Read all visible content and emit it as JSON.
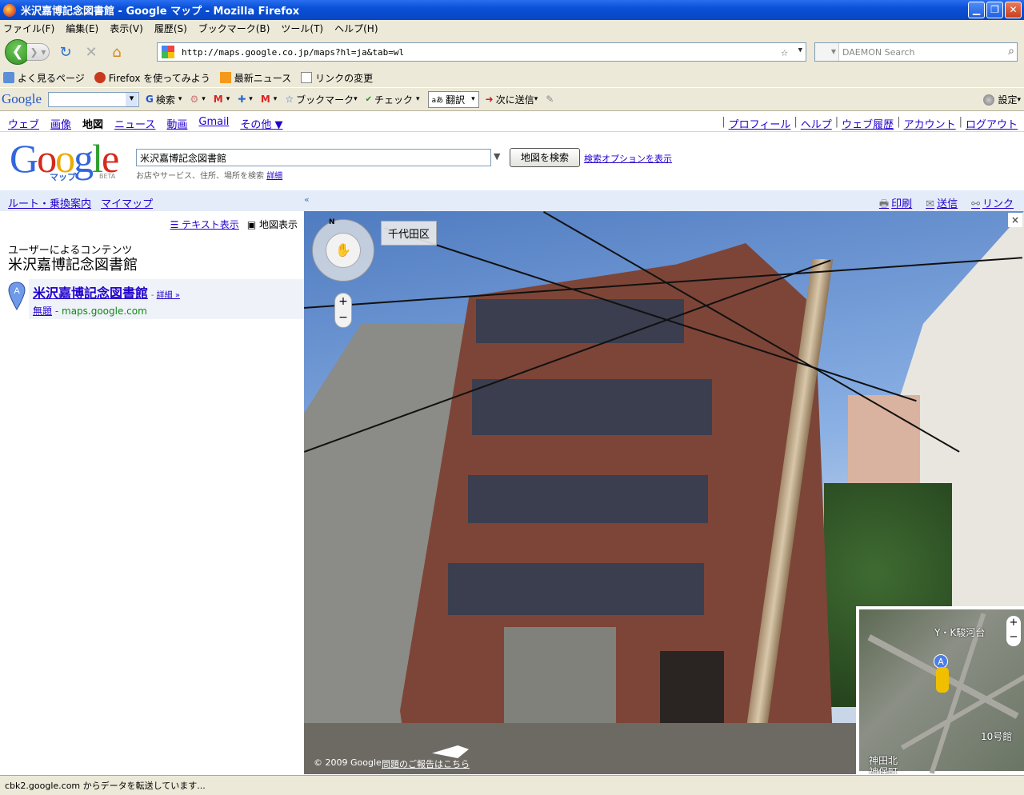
{
  "window": {
    "title": "米沢嘉博記念図書館 - Google マップ - Mozilla Firefox"
  },
  "menu": [
    "ファイル(F)",
    "編集(E)",
    "表示(V)",
    "履歴(S)",
    "ブックマーク(B)",
    "ツール(T)",
    "ヘルプ(H)"
  ],
  "nav": {
    "url": "http://maps.google.co.jp/maps?hl=ja&tab=wl",
    "search_placeholder": "DAEMON Search"
  },
  "bookmarks": [
    "よく見るページ",
    "Firefox を使ってみよう",
    "最新ニュース",
    "リンクの変更"
  ],
  "google_toolbar": {
    "logo": "Google",
    "search": "検索",
    "bookmarks": "ブックマーク",
    "check": "チェック",
    "translate": "翻訳",
    "send": "次に送信",
    "settings": "設定"
  },
  "gbar": {
    "left": [
      "ウェブ",
      "画像",
      "地図",
      "ニュース",
      "動画",
      "Gmail",
      "その他 ▼"
    ],
    "right": [
      "プロフィール",
      "ヘルプ",
      "ウェブ履歴",
      "アカウント",
      "ログアウト"
    ]
  },
  "header": {
    "logo_sub": "マップ",
    "beta": "BETA",
    "query": "米沢嘉博記念図書館",
    "search_button": "地図を検索",
    "search_options": "検索オプションを表示",
    "hint": "お店やサービス、住所、場所を検索",
    "hint_link": "詳細"
  },
  "linkbar": {
    "route": "ルート・乗換案内",
    "mymaps": "マイマップ",
    "collapse": "«",
    "print": "印刷",
    "send": "送信",
    "link": "リンク"
  },
  "panel": {
    "text_view": "テキスト表示",
    "map_view": "地図表示",
    "user_content": "ユーザーによるコンテンツ",
    "title": "米沢嘉博記念図書館",
    "result": {
      "marker": "A",
      "title": "米沢嘉博記念図書館",
      "detail": "詳細 »",
      "name_link": "無題",
      "source": "maps.google.com"
    }
  },
  "streetview": {
    "compass": "N",
    "district": "千代田区",
    "zoom_in": "+",
    "zoom_out": "−",
    "close": "×",
    "copyright": "© 2009 Google",
    "report": "問題のご報告はこちら",
    "minimap": {
      "label1": "Y・K駿河台",
      "label2": "10号館",
      "label3": "神田北",
      "label4": "神保町",
      "marker": "A"
    }
  },
  "status": "cbk2.google.com からデータを転送しています..."
}
